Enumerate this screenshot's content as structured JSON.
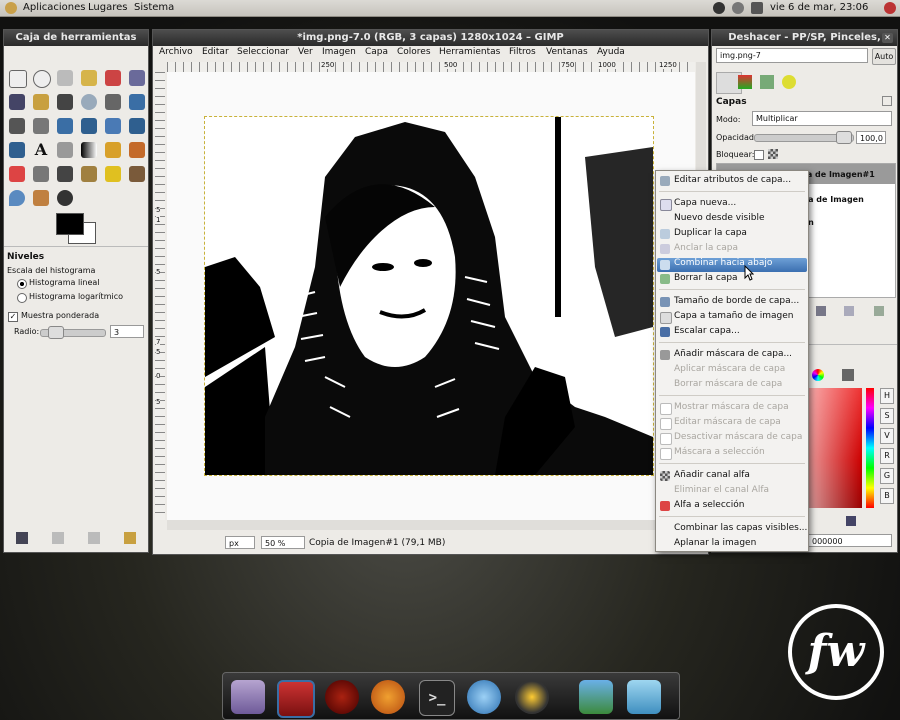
{
  "top_panel": {
    "menus": [
      "Aplicaciones",
      "Lugares",
      "Sistema"
    ],
    "clock": "vie  6 de mar, 23:06"
  },
  "toolbox": {
    "title": "Caja de herramientas",
    "levels_title": "Niveles",
    "histogram_label": "Escala del histograma",
    "linear": "Histograma lineal",
    "log": "Histograma logarítmico",
    "weighted": "Muestra ponderada",
    "radius_label": "Radio:",
    "radius_value": "3"
  },
  "image_window": {
    "title": "*img.png-7.0 (RGB, 3 capas) 1280x1024 – GIMP",
    "menus": [
      "Archivo",
      "Editar",
      "Seleccionar",
      "Ver",
      "Imagen",
      "Capa",
      "Colores",
      "Herramientas",
      "Filtros",
      "Ventanas",
      "Ayuda"
    ],
    "ruler_marks": [
      "250",
      "500",
      "750",
      "1000",
      "1250"
    ],
    "ruler_left_marks": [
      "5",
      "1",
      "5",
      "7",
      "5",
      "0",
      "5"
    ],
    "unit": "px",
    "zoom": "50 %",
    "status": "Copia de Imagen#1 (79,1 MB)"
  },
  "dock_window": {
    "title": "Deshacer - PP/SP, Pinceles,",
    "image_select": "img.png-7",
    "auto_button": "Auto",
    "layers_label": "Capas",
    "mode_label": "Modo:",
    "mode_value": "Multiplicar",
    "opacity_label": "Opacidad:",
    "opacity_value": "100,0",
    "lock_label": "Bloquear:",
    "layer_names": [
      "Copia de Imagen#1",
      "...a de Imagen",
      "...n"
    ],
    "hex_value": "000000",
    "channel_letters": [
      "H",
      "S",
      "V",
      "R",
      "G",
      "B"
    ]
  },
  "context_menu": {
    "items": [
      {
        "label": "Editar atributos de capa...",
        "enabled": true,
        "icon": "layer-attributes-icon"
      },
      {
        "label": "Capa nueva...",
        "enabled": true,
        "icon": "new-layer-icon"
      },
      {
        "label": "Nuevo desde visible",
        "enabled": true,
        "icon": ""
      },
      {
        "label": "Duplicar la capa",
        "enabled": true,
        "icon": "duplicate-icon"
      },
      {
        "label": "Anclar la capa",
        "enabled": false,
        "icon": "anchor-icon"
      },
      {
        "label": "Combinar hacia abajo",
        "enabled": true,
        "icon": "merge-down-icon",
        "highlighted": true
      },
      {
        "label": "Borrar la capa",
        "enabled": true,
        "icon": "delete-layer-icon"
      },
      {
        "label": "Tamaño de borde de capa...",
        "enabled": true,
        "icon": "layer-boundary-icon"
      },
      {
        "label": "Capa a tamaño de imagen",
        "enabled": true,
        "icon": "layer-to-image-icon"
      },
      {
        "label": "Escalar capa...",
        "enabled": true,
        "icon": "scale-icon"
      },
      {
        "label": "Añadir máscara de capa...",
        "enabled": true,
        "icon": "add-mask-icon"
      },
      {
        "label": "Aplicar máscara de capa",
        "enabled": false,
        "icon": ""
      },
      {
        "label": "Borrar máscara de capa",
        "enabled": false,
        "icon": ""
      },
      {
        "label": "Mostrar máscara de capa",
        "enabled": false,
        "icon": "checkbox"
      },
      {
        "label": "Editar máscara de capa",
        "enabled": false,
        "icon": "checkbox"
      },
      {
        "label": "Desactivar máscara de capa",
        "enabled": false,
        "icon": "checkbox"
      },
      {
        "label": "Máscara a selección",
        "enabled": false,
        "icon": "checkbox"
      },
      {
        "label": "Añadir canal alfa",
        "enabled": true,
        "icon": "alpha-icon"
      },
      {
        "label": "Eliminar el canal Alfa",
        "enabled": false,
        "icon": ""
      },
      {
        "label": "Alfa a selección",
        "enabled": true,
        "icon": "alpha-select-icon"
      },
      {
        "label": "Combinar las capas visibles...",
        "enabled": true,
        "icon": ""
      },
      {
        "label": "Aplanar la imagen",
        "enabled": true,
        "icon": ""
      }
    ]
  },
  "watermark": "fw",
  "colors": {
    "highlight": "#3b6fb0",
    "titlebar": "#2a2a2a",
    "panel": "#d6d3cc"
  }
}
